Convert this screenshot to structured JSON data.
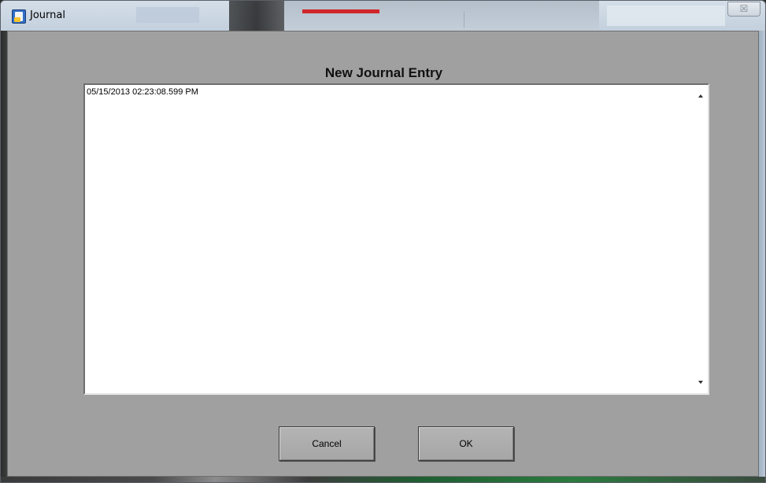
{
  "window": {
    "title": "Journal",
    "close_symbol": "☒",
    "icon": "journal-app-icon"
  },
  "dialog": {
    "heading": "New Journal Entry",
    "entry_value": "05/15/2013 02:23:08.599 PM"
  },
  "buttons": {
    "cancel_label": "Cancel",
    "ok_label": "OK"
  },
  "colors": {
    "client_background": "#a0a0a0",
    "text_area_background": "#ffffff",
    "button_face": "#ababab",
    "titlebar": "#c6d3e0"
  }
}
